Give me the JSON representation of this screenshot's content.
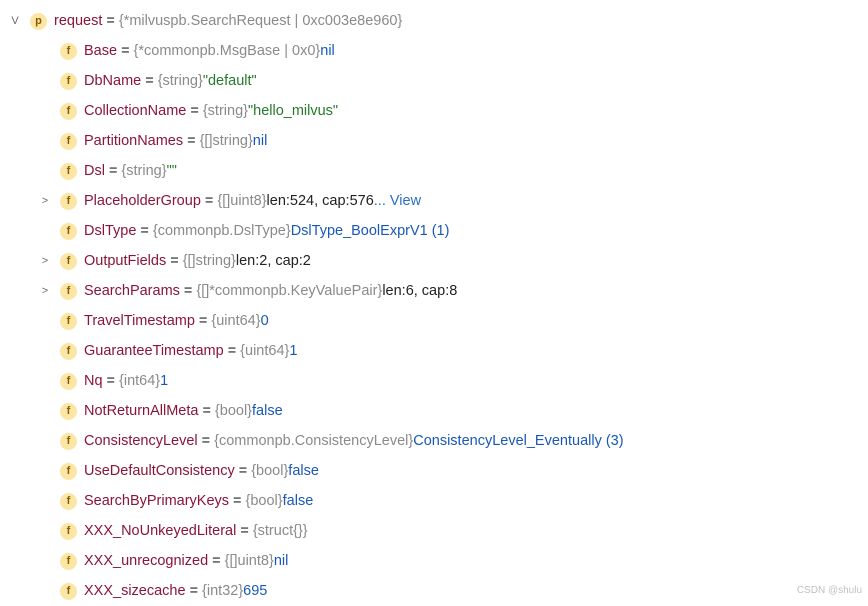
{
  "root": {
    "name": "request",
    "type": "{*milvuspb.SearchRequest | 0xc003e8e960}",
    "badge": "p"
  },
  "fields": [
    {
      "k": "Base",
      "name": "Base",
      "type": "{*commonpb.MsgBase | 0x0}",
      "val": "nil",
      "cls": "val-blue",
      "exp": ""
    },
    {
      "k": "DbName",
      "name": "DbName",
      "type": "{string}",
      "val": "\"default\"",
      "cls": "val-green",
      "exp": ""
    },
    {
      "k": "CollectionName",
      "name": "CollectionName",
      "type": "{string}",
      "val": "\"hello_milvus\"",
      "cls": "val-green",
      "exp": ""
    },
    {
      "k": "PartitionNames",
      "name": "PartitionNames",
      "type": "{[]string}",
      "val": "nil",
      "cls": "val-blue",
      "exp": ""
    },
    {
      "k": "Dsl",
      "name": "Dsl",
      "type": "{string}",
      "val": "\"\"",
      "cls": "val-green",
      "exp": ""
    },
    {
      "k": "PlaceholderGroup",
      "name": "PlaceholderGroup",
      "type": "{[]uint8}",
      "val": "len:524, cap:576",
      "cls": "",
      "exp": ">",
      "view": "... View"
    },
    {
      "k": "DslType",
      "name": "DslType",
      "type": "{commonpb.DslType}",
      "val": "DslType_BoolExprV1 (1)",
      "cls": "val-blue",
      "exp": ""
    },
    {
      "k": "OutputFields",
      "name": "OutputFields",
      "type": "{[]string}",
      "val": "len:2, cap:2",
      "cls": "",
      "exp": ">"
    },
    {
      "k": "SearchParams",
      "name": "SearchParams",
      "type": "{[]*commonpb.KeyValuePair}",
      "val": "len:6, cap:8",
      "cls": "",
      "exp": ">"
    },
    {
      "k": "TravelTimestamp",
      "name": "TravelTimestamp",
      "type": "{uint64}",
      "val": "0",
      "cls": "val-blue",
      "exp": ""
    },
    {
      "k": "GuaranteeTimestamp",
      "name": "GuaranteeTimestamp",
      "type": "{uint64}",
      "val": "1",
      "cls": "val-blue",
      "exp": ""
    },
    {
      "k": "Nq",
      "name": "Nq",
      "type": "{int64}",
      "val": "1",
      "cls": "val-blue",
      "exp": ""
    },
    {
      "k": "NotReturnAllMeta",
      "name": "NotReturnAllMeta",
      "type": "{bool}",
      "val": "false",
      "cls": "val-blue",
      "exp": ""
    },
    {
      "k": "ConsistencyLevel",
      "name": "ConsistencyLevel",
      "type": "{commonpb.ConsistencyLevel}",
      "val": "ConsistencyLevel_Eventually (3)",
      "cls": "val-blue",
      "exp": ""
    },
    {
      "k": "UseDefaultConsistency",
      "name": "UseDefaultConsistency",
      "type": "{bool}",
      "val": "false",
      "cls": "val-blue",
      "exp": ""
    },
    {
      "k": "SearchByPrimaryKeys",
      "name": "SearchByPrimaryKeys",
      "type": "{bool}",
      "val": "false",
      "cls": "val-blue",
      "exp": ""
    },
    {
      "k": "XXX_NoUnkeyedLiteral",
      "name": "XXX_NoUnkeyedLiteral",
      "type": "{struct{}}",
      "val": "",
      "cls": "",
      "exp": ""
    },
    {
      "k": "XXX_unrecognized",
      "name": "XXX_unrecognized",
      "type": "{[]uint8}",
      "val": "nil",
      "cls": "val-blue",
      "exp": ""
    },
    {
      "k": "XXX_sizecache",
      "name": "XXX_sizecache",
      "type": "{int32}",
      "val": "695",
      "cls": "val-blue",
      "exp": ""
    }
  ],
  "watermark": "CSDN @shulu"
}
